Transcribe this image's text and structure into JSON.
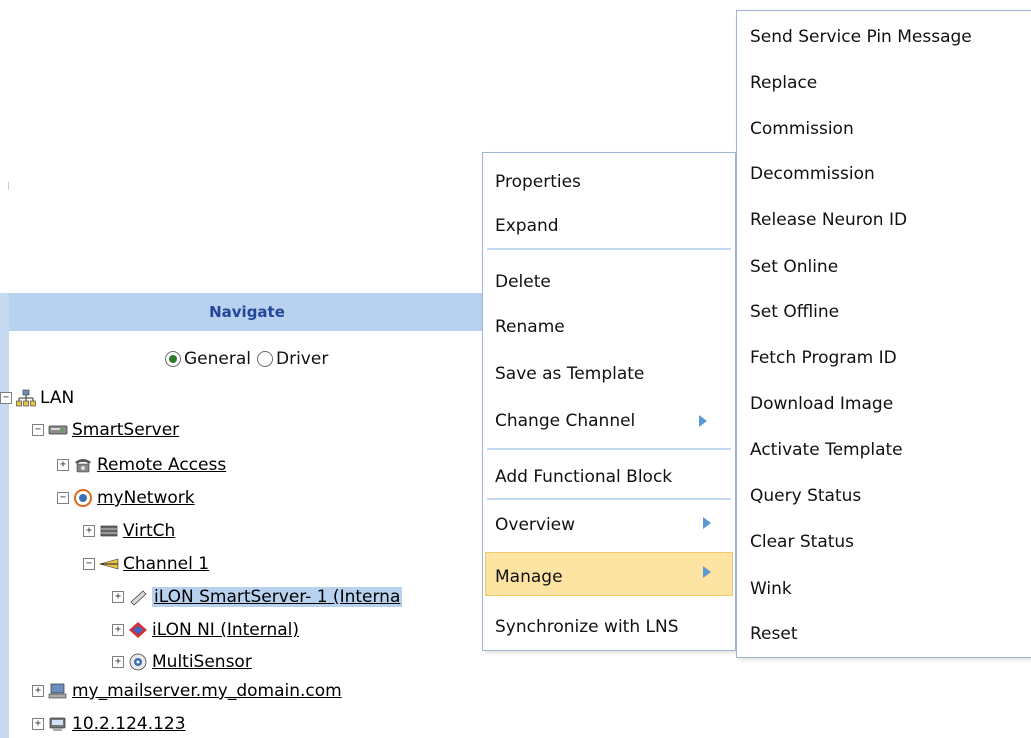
{
  "navigate": {
    "header": "Navigate",
    "radio_general": "General",
    "radio_driver": "Driver",
    "selected_view": "General"
  },
  "tree": {
    "lan": "LAN",
    "smartserver": "SmartServer",
    "remote_access": "Remote Access",
    "mynetwork": "myNetwork",
    "virtch": "VirtCh",
    "channel1": "Channel 1",
    "ilon_smartserver": "iLON SmartServer- 1 (Interna",
    "ilon_ni": "iLON NI (Internal)",
    "multisensor": "MultiSensor",
    "mailserver": "my_mailserver.my_domain.com",
    "ip": "10.2.124.123"
  },
  "context_menu": {
    "properties": "Properties",
    "expand": "Expand",
    "delete": "Delete",
    "rename": "Rename",
    "save_as_template": "Save as Template",
    "change_channel": "Change Channel",
    "add_functional_block": "Add Functional Block",
    "overview": "Overview",
    "manage": "Manage",
    "synchronize": "Synchronize with LNS"
  },
  "manage_submenu": {
    "send_service_pin": "Send Service Pin Message",
    "replace": "Replace",
    "commission": "Commission",
    "decommission": "Decommission",
    "release_neuron_id": "Release Neuron ID",
    "set_online": "Set Online",
    "set_offline": "Set Offline",
    "fetch_program_id": "Fetch Program ID",
    "download_image": "Download Image",
    "activate_template": "Activate Template",
    "query_status": "Query Status",
    "clear_status": "Clear Status",
    "wink": "Wink",
    "reset": "Reset"
  },
  "colors": {
    "header_bg": "#b8d1ef",
    "header_text": "#21479a",
    "menu_border": "#9fb7d5",
    "highlight": "#fde4a3",
    "submenu_arrow": "#5b9bd5"
  }
}
